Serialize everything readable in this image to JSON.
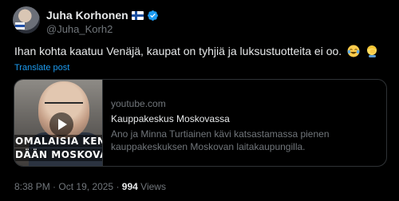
{
  "author": {
    "display_name": "Juha Korhonen",
    "handle": "@Juha_Korh2",
    "flag_icon": "finland-flag-icon",
    "verified_icon": "verified-badge-icon",
    "verified_color": "#1d9bf0"
  },
  "post": {
    "text": "Ihan kohta kaatuu Venäjä, kaupat on tyhjiä ja luksustuotteita ei oo.",
    "emojis": [
      "face-with-tears-of-joy-emoji",
      "facepalm-emoji"
    ],
    "translate_label": "Translate post"
  },
  "card": {
    "thumbnail_caption_line1": "OMALAISIA KEN",
    "thumbnail_caption_line2": "DÄÄN MOSKOVA",
    "play_icon": "play-icon",
    "domain": "youtube.com",
    "title": "Kauppakeskus Moskovassa",
    "description": "Ano ja Minna Turtiainen kävi katsastamassa pienen kauppakeskuksen Moskovan laitakaupungilla."
  },
  "meta": {
    "time": "8:38 PM",
    "separator": "·",
    "date": "Oct 19, 2025",
    "views_count": "994",
    "views_label": "Views"
  },
  "colors": {
    "background": "#000000",
    "text": "#e7e9ea",
    "secondary": "#71767b",
    "link": "#1d9bf0",
    "border": "#2f3336"
  }
}
